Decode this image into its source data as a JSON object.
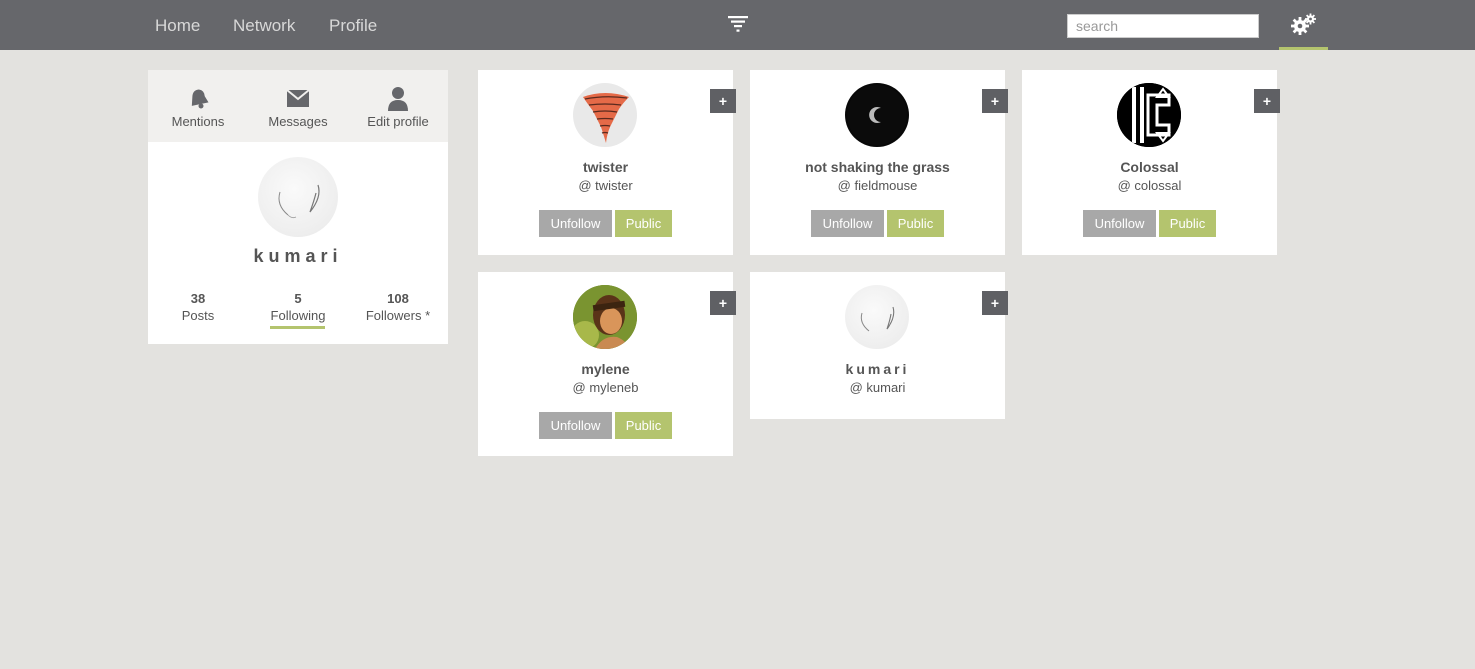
{
  "nav": {
    "home": "Home",
    "network": "Network",
    "profile": "Profile",
    "search_placeholder": "search",
    "accent_color": "#b4c46e"
  },
  "sidebar": {
    "actions": [
      {
        "label": "Mentions",
        "icon": "bell-icon"
      },
      {
        "label": "Messages",
        "icon": "envelope-icon"
      },
      {
        "label": "Edit profile",
        "icon": "user-icon"
      }
    ],
    "name": "kumari",
    "stats": [
      {
        "num": "38",
        "label": "Posts"
      },
      {
        "num": "5",
        "label": "Following"
      },
      {
        "num": "108",
        "label": "Followers *"
      }
    ]
  },
  "cards": [
    {
      "name": "twister",
      "handle": "@ twister",
      "plus": "+",
      "unfollow": "Unfollow",
      "public": "Public"
    },
    {
      "name": "not shaking the grass",
      "handle": "@ fieldmouse",
      "plus": "+",
      "unfollow": "Unfollow",
      "public": "Public"
    },
    {
      "name": "Colossal",
      "handle": "@ colossal",
      "plus": "+",
      "unfollow": "Unfollow",
      "public": "Public"
    },
    {
      "name": "mylene",
      "handle": "@ myleneb",
      "plus": "+",
      "unfollow": "Unfollow",
      "public": "Public"
    },
    {
      "name": "kumari",
      "handle": "@ kumari",
      "plus": "+"
    }
  ]
}
